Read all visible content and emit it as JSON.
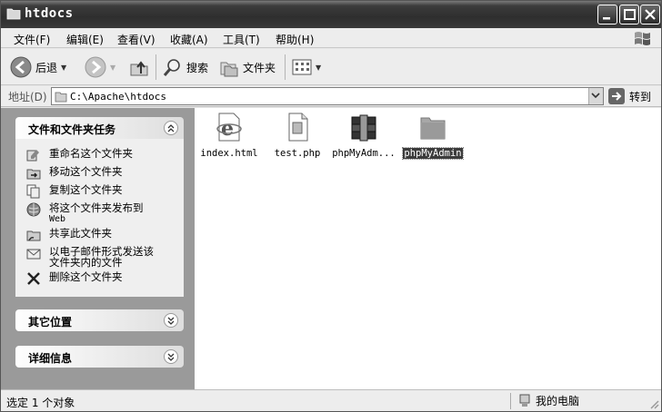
{
  "window": {
    "title": "htdocs"
  },
  "menu": [
    "文件(F)",
    "编辑(E)",
    "查看(V)",
    "收藏(A)",
    "工具(T)",
    "帮助(H)"
  ],
  "toolbar": {
    "back_label": "后退",
    "search_label": "搜索",
    "folders_label": "文件夹"
  },
  "address": {
    "label": "地址(D)",
    "path": "C:\\Apache\\htdocs",
    "go_label": "转到"
  },
  "taskpane": {
    "tasks_title": "文件和文件夹任务",
    "tasks": [
      {
        "label": "重命名这个文件夹",
        "icon": "rename-icon"
      },
      {
        "label": "移动这个文件夹",
        "icon": "move-icon"
      },
      {
        "label": "复制这个文件夹",
        "icon": "copy-icon"
      },
      {
        "label": "将这个文件夹发布到",
        "sub": "Web",
        "icon": "publish-web-icon"
      },
      {
        "label": "共享此文件夹",
        "icon": "share-icon"
      },
      {
        "label": "以电子邮件形式发送该",
        "sub2": "文件夹内的文件",
        "icon": "email-icon"
      },
      {
        "label": "删除这个文件夹",
        "icon": "delete-icon"
      }
    ],
    "other_places_title": "其它位置",
    "details_title": "详细信息"
  },
  "files": [
    {
      "name": "index.html",
      "icon": "ie-html-icon",
      "selected": false
    },
    {
      "name": "test.php",
      "icon": "php-file-icon",
      "selected": false
    },
    {
      "name": "phpMyAdm...",
      "icon": "winrar-archive-icon",
      "selected": false
    },
    {
      "name": "phpMyAdmin",
      "icon": "folder-icon",
      "selected": true
    }
  ],
  "status": {
    "left": "选定 1 个对象",
    "right": "我的电脑"
  }
}
